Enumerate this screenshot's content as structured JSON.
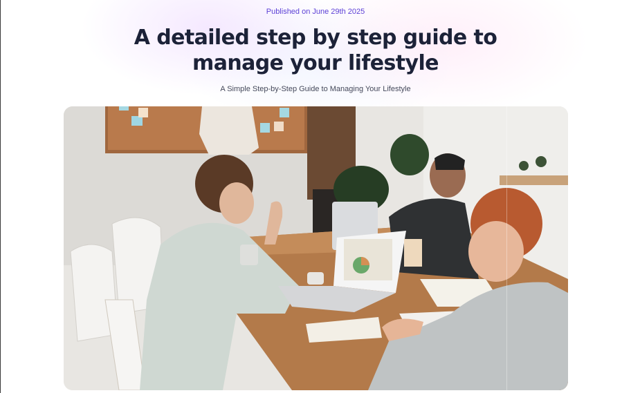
{
  "article": {
    "published": "Published on June 29th 2025",
    "title_line1": "A detailed step by step guide to",
    "title_line2": "manage your lifestyle",
    "subtitle": "A Simple Step-by-Step Guide to Managing Your Lifestyle"
  },
  "colors": {
    "accent": "#5b3fd6",
    "title": "#1c2238",
    "subtitle": "#44485a"
  }
}
